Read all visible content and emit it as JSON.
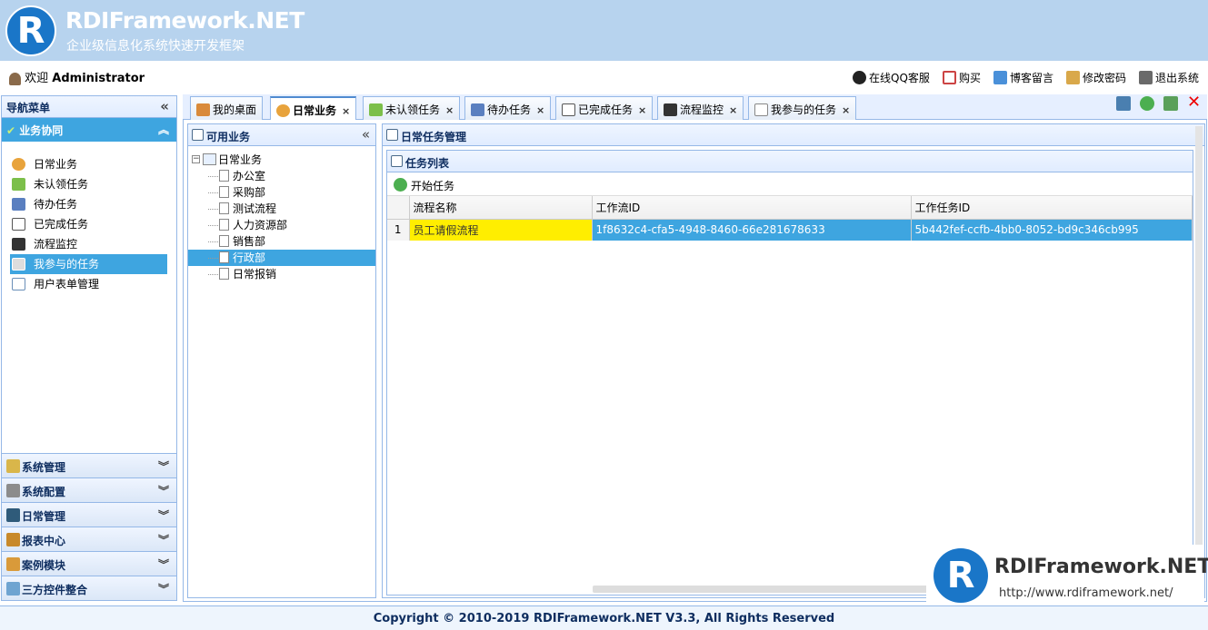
{
  "brand": {
    "title": "RDIFramework.NET",
    "subtitle": "企业级信息化系统快速开发框架",
    "logo_letter": "R"
  },
  "userbar": {
    "welcome": "欢迎",
    "username": "Administrator",
    "links": [
      {
        "label": "在线QQ客服",
        "icon": "qq-icon"
      },
      {
        "label": "购买",
        "icon": "cart-icon"
      },
      {
        "label": "博客留言",
        "icon": "blog-icon"
      },
      {
        "label": "修改密码",
        "icon": "edit-password-icon"
      },
      {
        "label": "退出系统",
        "icon": "logout-icon"
      }
    ]
  },
  "nav": {
    "title": "导航菜单",
    "active_group": "业务协同",
    "items": [
      {
        "label": "日常业务",
        "color": "#e8a33c"
      },
      {
        "label": "未认领任务",
        "color": "#7cbf4a"
      },
      {
        "label": "待办任务",
        "color": "#5a7fc0"
      },
      {
        "label": "已完成任务",
        "color": "#7a7a7a"
      },
      {
        "label": "流程监控",
        "color": "#333333"
      },
      {
        "label": "我参与的任务",
        "color": "#888888"
      },
      {
        "label": "用户表单管理",
        "color": "#6a8fb8"
      }
    ],
    "groups": [
      {
        "label": "系统管理",
        "color": "#d9b64a"
      },
      {
        "label": "系统配置",
        "color": "#8c8c8c"
      },
      {
        "label": "日常管理",
        "color": "#2f5b7a"
      },
      {
        "label": "报表中心",
        "color": "#c8892a"
      },
      {
        "label": "案例模块",
        "color": "#d99a3a"
      },
      {
        "label": "三方控件整合",
        "color": "#6fa4d1"
      }
    ]
  },
  "tabs": [
    {
      "label": "我的桌面",
      "closable": false
    },
    {
      "label": "日常业务",
      "closable": true,
      "active": true
    },
    {
      "label": "未认领任务",
      "closable": true
    },
    {
      "label": "待办任务",
      "closable": true
    },
    {
      "label": "已完成任务",
      "closable": true
    },
    {
      "label": "流程监控",
      "closable": true
    },
    {
      "label": "我参与的任务",
      "closable": true
    }
  ],
  "tree_panel": {
    "title": "可用业务",
    "root": "日常业务",
    "children": [
      "办公室",
      "采购部",
      "测试流程",
      "人力资源部",
      "销售部",
      "行政部",
      "日常报销"
    ],
    "selected": "行政部"
  },
  "main_panel": {
    "title": "日常任务管理",
    "grid_title": "任务列表",
    "toolbar_start": "开始任务",
    "columns": [
      "流程名称",
      "工作流ID",
      "工作任务ID"
    ],
    "rows": [
      {
        "num": "1",
        "name": "员工请假流程",
        "workflow_id": "1f8632c4-cfa5-4948-8460-66e281678633",
        "task_id": "5b442fef-ccfb-4bb0-8052-bd9c346cb995"
      }
    ]
  },
  "footer": {
    "text": "Copyright © 2010-2019 RDIFramework.NET V3.3, All Rights Reserved"
  },
  "watermark": {
    "title": "RDIFramework.NET",
    "url": "http://www.rdiframework.net/",
    "logo_letter": "R"
  }
}
